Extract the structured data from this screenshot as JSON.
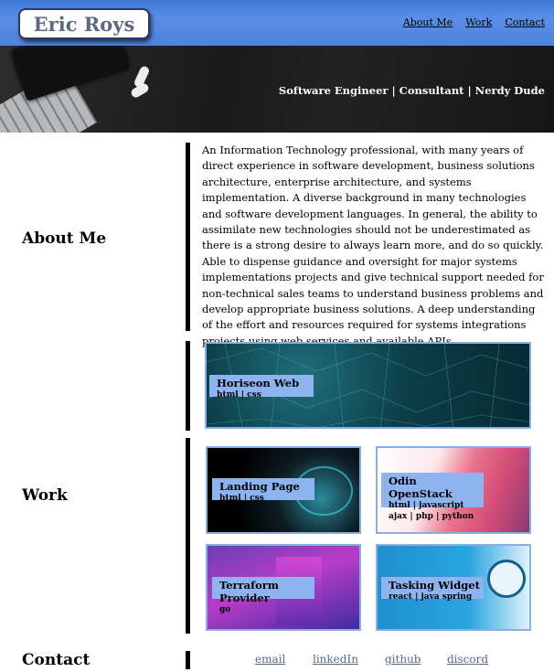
{
  "header": {
    "logo": "Eric Roys",
    "nav": {
      "about": "About Me",
      "work": "Work",
      "contact": "Contact"
    }
  },
  "hero": {
    "tagline": "Software Engineer | Consultant | Nerdy Dude"
  },
  "about": {
    "title": "About Me",
    "text": "An Information Technology professional, with many years of direct experience in software development, business solutions architecture, enterprise architecture, and systems implementation. A diverse background in many technologies and software development languages. In general, the ability to assimilate new technologies should not be underestimated as there is a strong desire to always learn more, and do so quickly. Able to dispense guidance and oversight for major systems implementations projects and give technical support needed for non-technical sales teams to understand business problems and develop appropriate business solutions. A deep understanding of the effort and resources required for systems integrations projects using web services and available APIs."
  },
  "work": {
    "title": "Work",
    "projects": [
      {
        "title": "Horiseon Web",
        "tags": [
          "html | css"
        ]
      },
      {
        "title": "Landing Page",
        "tags": [
          "html | css"
        ]
      },
      {
        "title": "Odin OpenStack",
        "tags": [
          "html | javascript",
          "ajax | php | python"
        ]
      },
      {
        "title": "Terraform Provider",
        "tags": [
          "go"
        ]
      },
      {
        "title": "Tasking Widget",
        "tags": [
          "react | java spring"
        ]
      }
    ]
  },
  "contact": {
    "title": "Contact",
    "links": {
      "email": "email",
      "linkedin": "linkedIn",
      "github": "github",
      "discord": "discord"
    }
  }
}
